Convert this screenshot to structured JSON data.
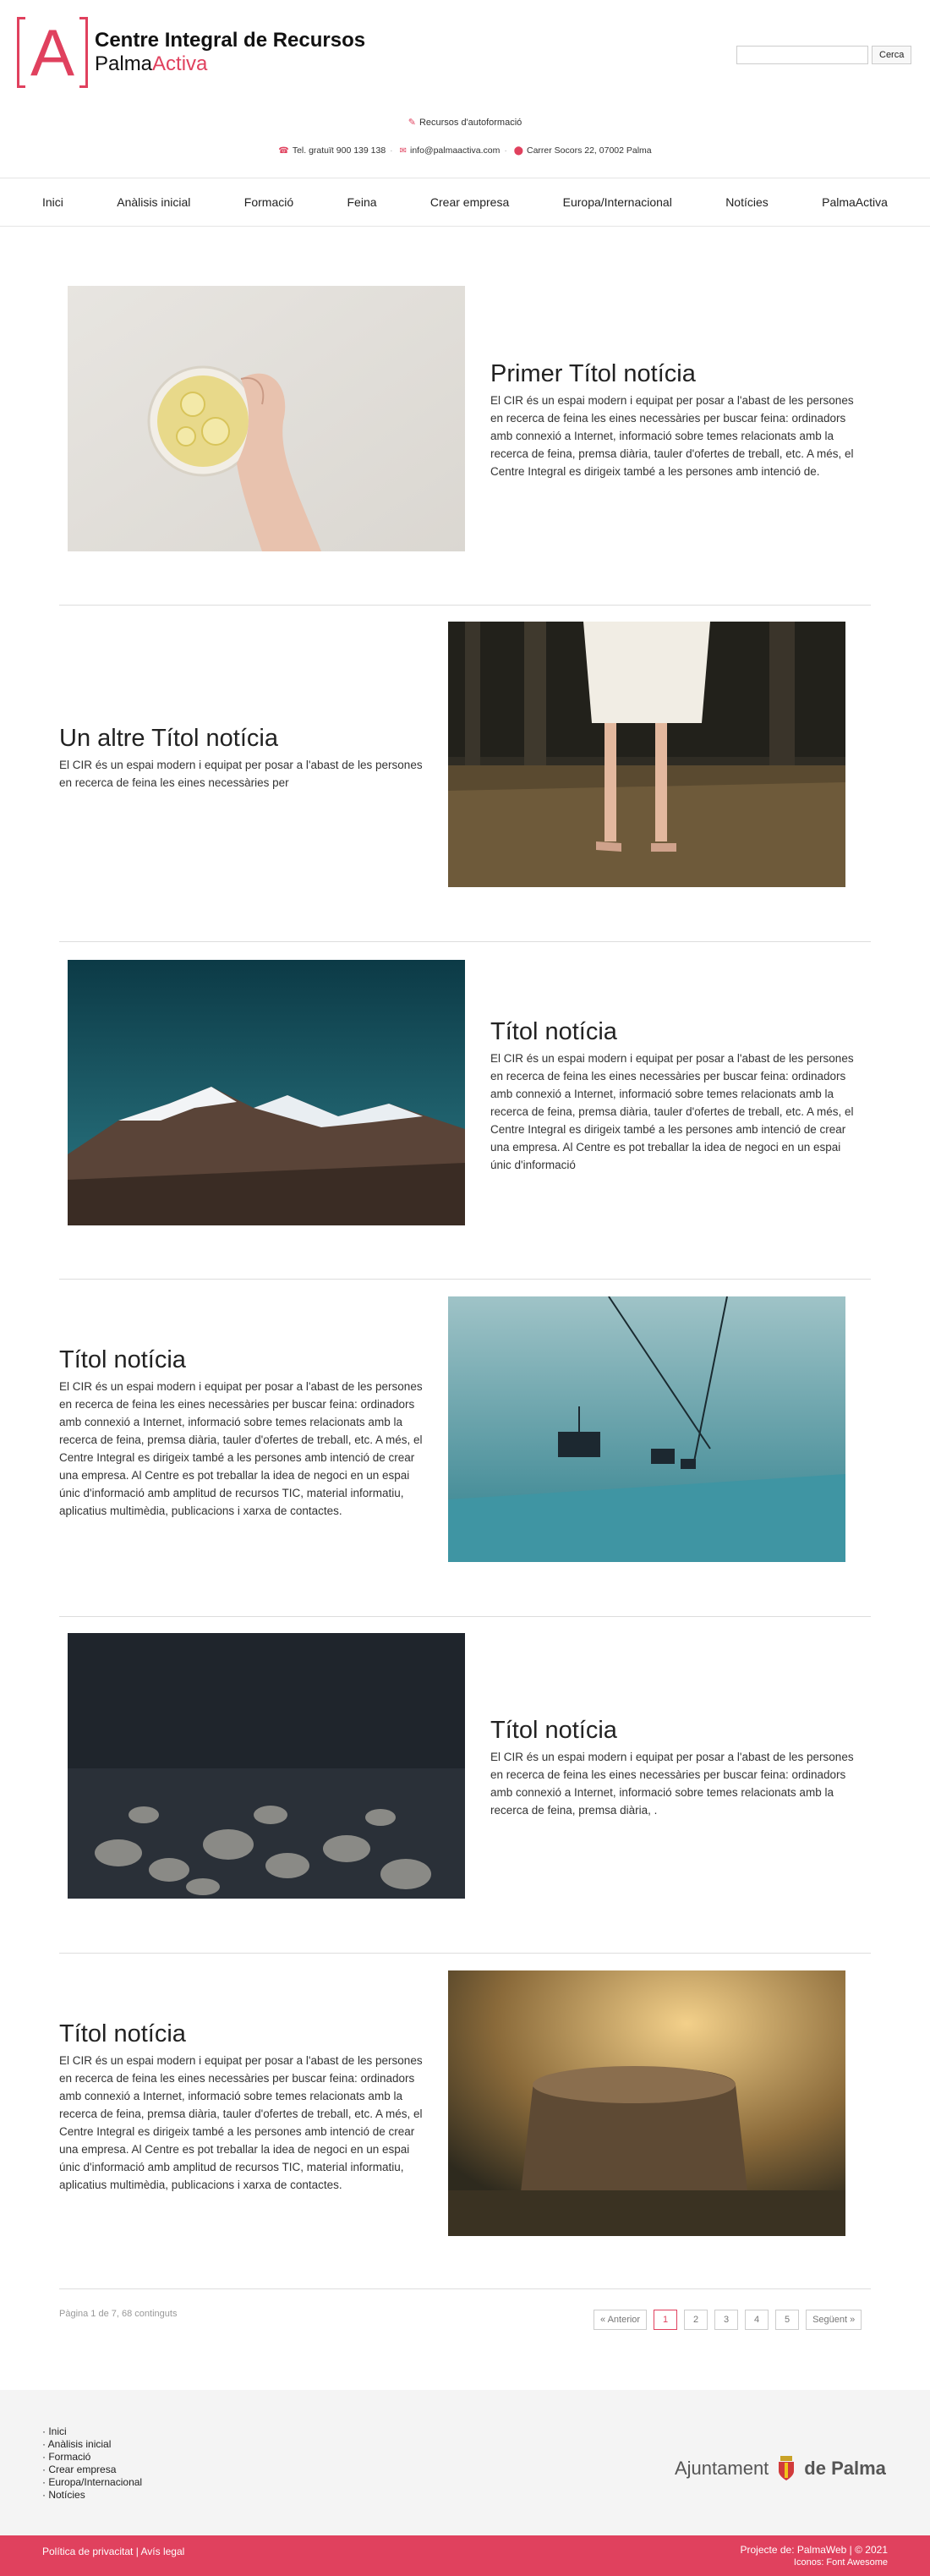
{
  "brand": {
    "logo_letter": "A",
    "title": "Centre Integral de Recursos",
    "sub_plain": "Palma",
    "sub_accent": "Activa"
  },
  "search": {
    "placeholder": "",
    "button": "Cerca"
  },
  "self_learning": "Recursos d'autoformació",
  "contact": {
    "phone": "Tel. gratuït 900 139 138",
    "email": "info@palmaactiva.com",
    "address": "Carrer Socors 22, 07002 Palma"
  },
  "nav": [
    "Inici",
    "Anàlisis inicial",
    "Formació",
    "Feina",
    "Crear empresa",
    "Europa/Internacional",
    "Notícies",
    "PalmaActiva"
  ],
  "news": [
    {
      "title": "Primer Títol notícia",
      "body": "El CIR és un espai modern i equipat per posar a l'abast de les persones en recerca de feina les eines necessàries per buscar feina: ordinadors amb connexió a Internet, informació sobre temes relacionats amb la recerca de feina, premsa diària, tauler d'ofertes de treball, etc. A més, el Centre Integral es dirigeix també a les persones amb intenció de.",
      "image": "bowl-with-lemon"
    },
    {
      "title": "Un altre Títol notícia",
      "body": "El CIR és un espai modern i equipat per posar a l'abast de les persones en recerca de feina les eines necessàries per",
      "image": "woman-in-forest"
    },
    {
      "title": "Títol notícia",
      "body": "El CIR és un espai modern i equipat per posar a l'abast de les persones en recerca de feina les eines necessàries per buscar feina: ordinadors amb connexió a Internet, informació sobre temes relacionats amb la recerca de feina, premsa diària, tauler d'ofertes de treball, etc. A més, el Centre Integral es dirigeix també a les persones amb intenció de crear una empresa. Al Centre es pot treballar la idea de negoci en un espai únic d'informació",
      "image": "snowy-mountains"
    },
    {
      "title": "Títol notícia",
      "body": "El CIR és un espai modern i equipat per posar a l'abast de les persones en recerca de feina les eines necessàries per buscar feina: ordinadors amb connexió a Internet, informació sobre temes relacionats amb la recerca de feina, premsa diària, tauler d'ofertes de treball, etc. A més, el Centre Integral es dirigeix també a les persones amb intenció de crear una empresa. Al Centre es pot treballar la idea de negoci en un espai únic d'informació amb amplitud de recursos TIC, material informatiu, aplicatius multimèdia, publicacions i xarxa de contactes.",
      "image": "ski-lift"
    },
    {
      "title": "Títol notícia",
      "body": "El CIR és un espai modern i equipat per posar a l'abast de les persones en recerca de feina les eines necessàries per buscar feina: ordinadors amb connexió a Internet, informació sobre temes relacionats amb la recerca de feina, premsa diària, .",
      "image": "pebbles-underwater"
    },
    {
      "title": "Títol notícia",
      "body": "El CIR és un espai modern i equipat per posar a l'abast de les persones en recerca de feina les eines necessàries per buscar feina: ordinadors amb connexió a Internet, informació sobre temes relacionats amb la recerca de feina, premsa diària, tauler d'ofertes de treball, etc. A més, el Centre Integral es dirigeix també a les persones amb intenció de crear una empresa. Al Centre es pot treballar la idea de negoci en un espai únic d'informació amb amplitud de recursos TIC, material informatiu, aplicatius multimèdia, publicacions i xarxa de contactes.",
      "image": "tree-stump-sunset"
    }
  ],
  "pager": {
    "info": "Pàgina 1 de 7, 68 continguts",
    "prev": "« Anterior",
    "pages": [
      "1",
      "2",
      "3",
      "4",
      "5"
    ],
    "current": "1",
    "next": "Següent »"
  },
  "footer": {
    "links": [
      "Inici",
      "Anàlisis inicial",
      "Formació",
      "Crear empresa",
      "Europa/Internacional",
      "Notícies"
    ],
    "ajuntament_word": "Ajuntament",
    "ajuntament_place": "de Palma",
    "legal": "Política de privacitat | Avís legal",
    "credit1": "Projecte de: PalmaWeb | © 2021",
    "credit2": "Iconos: Font Awesome"
  },
  "colors": {
    "accent": "#e0415e",
    "footer_bg": "#f4f4f4"
  }
}
